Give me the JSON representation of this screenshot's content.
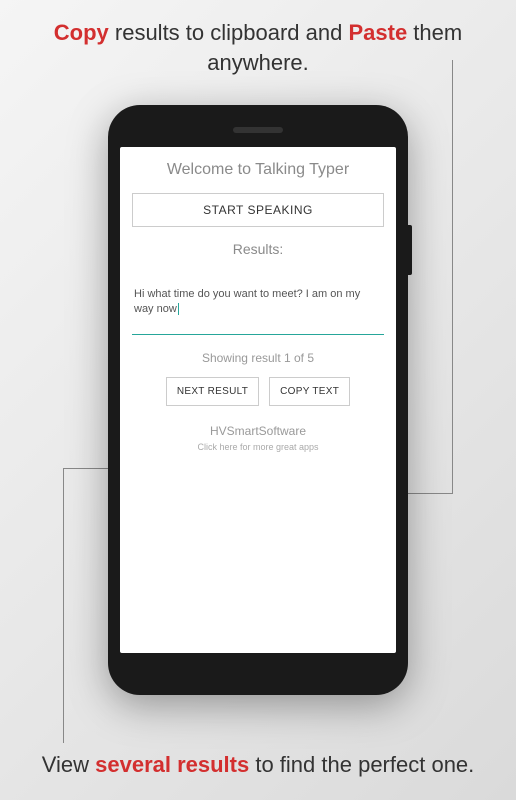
{
  "marketing": {
    "top": {
      "word1": "Copy",
      "text1": " results to clipboard and ",
      "word2": "Paste",
      "text2": " them anywhere."
    },
    "bottom": {
      "text1": "View ",
      "word1": "several results",
      "text2": " to find the perfect one."
    }
  },
  "app": {
    "title": "Welcome to Talking Typer",
    "start_button": "START SPEAKING",
    "results_label": "Results:",
    "result_text": "Hi what time do you want to meet? I am on my way now",
    "result_status": "Showing result 1 of 5",
    "next_button": "NEXT RESULT",
    "copy_button": "COPY TEXT",
    "company": "HVSmartSoftware",
    "more_apps": "Click here for more great apps"
  }
}
